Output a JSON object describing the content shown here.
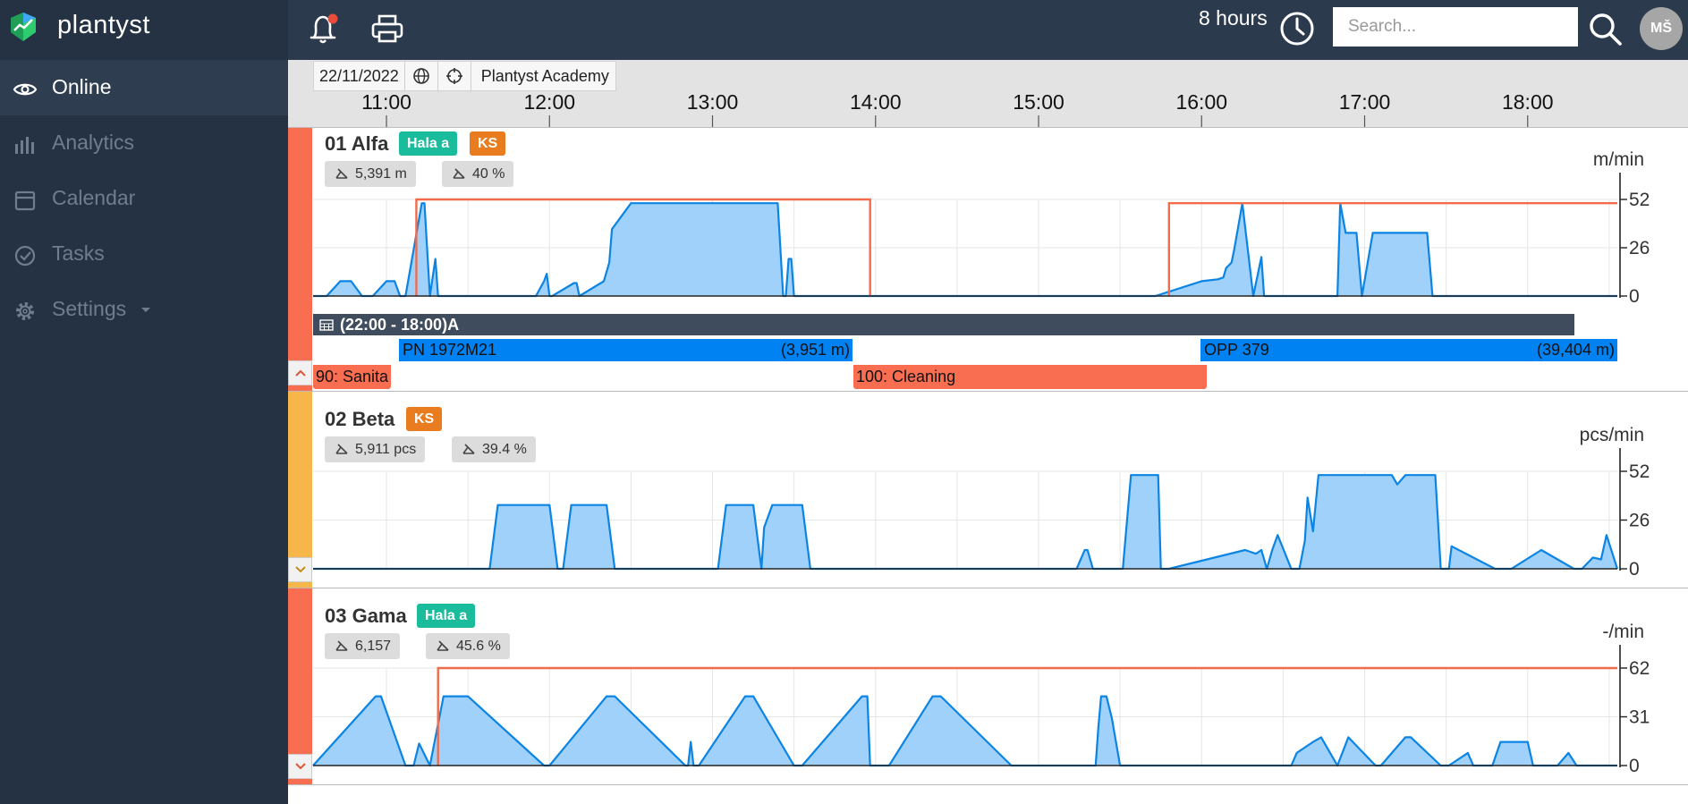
{
  "brand": {
    "name": "plantyst"
  },
  "nav": [
    {
      "label": "Online",
      "icon": "eye-icon",
      "active": true
    },
    {
      "label": "Analytics",
      "icon": "bar-chart-icon",
      "active": false
    },
    {
      "label": "Calendar",
      "icon": "calendar-icon",
      "active": false
    },
    {
      "label": "Tasks",
      "icon": "check-circle-icon",
      "active": false
    },
    {
      "label": "Settings",
      "icon": "gear-icon",
      "active": false,
      "has_dropdown": true
    }
  ],
  "topbar": {
    "notification_icon": "bell-icon",
    "notification_badge_color": "#e74c3c",
    "print_icon": "printer-icon",
    "time_range_label": "8 hours",
    "time_range_icon": "clock-icon",
    "search_placeholder": "Search...",
    "search_value": "",
    "search_icon": "search-icon",
    "avatar_initials": "MŠ"
  },
  "timeline": {
    "date": "22/11/2022",
    "timezone_icon": "globe-icon",
    "locate_icon": "crosshair-icon",
    "factory": "Plantyst Academy",
    "ticks": [
      "11:00",
      "12:00",
      "13:00",
      "14:00",
      "15:00",
      "16:00",
      "17:00",
      "18:00"
    ]
  },
  "colors": {
    "alarm": "#f96e51",
    "warning": "#f6b64a",
    "series_line": "#0b84e4",
    "series_fill": "#9fd1fa",
    "target_line": "#f26b4b",
    "tag_teal": "#1abc9c",
    "tag_orange": "#e87c1e",
    "order_bar": "#0082f2",
    "shift_bar": "#3e4c5e"
  },
  "machines": [
    {
      "name": "01 Alfa",
      "tags": [
        {
          "label": "Hala a",
          "color": "teal"
        },
        {
          "label": "KS",
          "color": "orange"
        }
      ],
      "stats": [
        {
          "label": "5,391 m"
        },
        {
          "label": "40 %"
        }
      ],
      "status_color": "#f96e51",
      "collapse_icon": "chevron-up-icon",
      "shift": {
        "label": "(22:00 - 18:00)",
        "code": "A",
        "icon": "calendar-grid-icon"
      },
      "orders": [
        {
          "name": "PN 1972M21",
          "amount": "(3,951 m)"
        },
        {
          "name": "OPP 379",
          "amount": "(39,404 m)"
        }
      ],
      "events": [
        {
          "label": "90: Sanita"
        },
        {
          "label": "100: Cleaning"
        }
      ]
    },
    {
      "name": "02 Beta",
      "tags": [
        {
          "label": "KS",
          "color": "orange"
        }
      ],
      "stats": [
        {
          "label": "5,911 pcs"
        },
        {
          "label": "39.4 %"
        }
      ],
      "status_color": "#f6b64a",
      "collapse_icon": "chevron-down-icon"
    },
    {
      "name": "03 Gama",
      "tags": [
        {
          "label": "Hala a",
          "color": "teal"
        }
      ],
      "stats": [
        {
          "label": "6,157"
        },
        {
          "label": "45.6 %"
        }
      ],
      "status_color": "#f96e51",
      "collapse_icon": "chevron-down-icon"
    }
  ],
  "chart_data": [
    {
      "type": "area",
      "xlabel": "",
      "ylabel": "m/min",
      "xlim": [
        "10:33",
        "18:33"
      ],
      "ylim": [
        0,
        52
      ],
      "yticks": [
        0,
        26,
        52
      ],
      "series": [
        {
          "x": [
            "10:33",
            "10:38",
            "10:43",
            "10:47",
            "10:51",
            "10:55",
            "11:00",
            "11:03",
            "11:05",
            "11:07",
            "11:13",
            "11:14",
            "11:16",
            "11:18",
            "11:19",
            "11:20",
            "11:22",
            "11:24",
            "11:55",
            "11:58",
            "11:59",
            "12:00",
            "12:01",
            "12:09",
            "12:10",
            "12:11",
            "12:20",
            "12:22",
            "12:23",
            "12:30",
            "12:33",
            "12:59",
            "13:24",
            "13:26",
            "13:27",
            "13:28",
            "13:29",
            "13:30",
            "13:32",
            "13:34",
            "15:43",
            "16:00",
            "16:06",
            "16:08",
            "16:09",
            "16:11",
            "16:12",
            "16:15",
            "16:19",
            "16:22",
            "16:23",
            "16:25",
            "16:26",
            "16:28",
            "16:34",
            "16:50",
            "16:51",
            "16:53",
            "16:57",
            "16:59",
            "17:03",
            "17:23",
            "17:25",
            "18:33"
          ],
          "y": [
            0,
            0,
            8,
            8,
            0,
            0,
            8,
            8,
            0,
            0,
            50,
            50,
            0,
            20,
            0,
            0,
            0,
            0,
            0,
            8,
            12,
            0,
            0,
            7,
            7,
            0,
            8,
            18,
            36,
            50,
            50,
            50,
            50,
            0,
            0,
            20,
            20,
            0,
            0,
            0,
            0,
            8,
            9,
            10,
            15,
            18,
            25,
            50,
            0,
            21,
            0,
            0,
            0,
            0,
            0,
            0,
            50,
            34,
            34,
            0,
            34,
            34,
            0,
            0
          ]
        }
      ],
      "targets": [
        {
          "start": "11:11",
          "end": "13:58",
          "y": 52
        },
        {
          "start": "15:48",
          "end": "18:33",
          "y": 50
        }
      ]
    },
    {
      "type": "area",
      "xlabel": "",
      "ylabel": "pcs/min",
      "xlim": [
        "10:33",
        "18:33"
      ],
      "ylim": [
        0,
        52
      ],
      "yticks": [
        0,
        26,
        52
      ],
      "series": [
        {
          "x": [
            "10:33",
            "11:38",
            "11:41",
            "12:00",
            "12:03",
            "12:05",
            "12:08",
            "12:21",
            "12:24",
            "13:02",
            "13:05",
            "13:15",
            "13:18",
            "13:19",
            "13:22",
            "13:33",
            "13:36",
            "15:14",
            "15:17",
            "15:18",
            "15:20",
            "15:31",
            "15:34",
            "15:44",
            "15:45",
            "15:48",
            "16:16",
            "16:20",
            "16:22",
            "16:24",
            "16:26",
            "16:28",
            "16:33",
            "16:36",
            "16:38",
            "16:39",
            "16:41",
            "16:43",
            "16:45",
            "17:10",
            "17:12",
            "17:15",
            "17:18",
            "17:20",
            "17:22",
            "17:24",
            "17:26",
            "17:28",
            "17:31",
            "17:32",
            "17:48",
            "17:54",
            "18:05",
            "18:17",
            "18:20",
            "18:24",
            "18:27",
            "18:29",
            "18:33"
          ],
          "y": [
            0,
            0,
            34,
            34,
            0,
            0,
            34,
            34,
            0,
            0,
            34,
            34,
            0,
            22,
            34,
            34,
            0,
            0,
            10,
            10,
            0,
            0,
            50,
            50,
            0,
            0,
            10,
            8,
            10,
            0,
            10,
            18,
            0,
            0,
            15,
            38,
            20,
            50,
            50,
            50,
            45,
            50,
            50,
            50,
            50,
            50,
            50,
            0,
            0,
            12,
            0,
            0,
            10,
            0,
            0,
            6,
            5,
            18,
            0
          ]
        }
      ],
      "targets": []
    },
    {
      "type": "area",
      "xlabel": "",
      "ylabel": "-/min",
      "xlim": [
        "10:33",
        "18:33"
      ],
      "ylim": [
        0,
        62
      ],
      "yticks": [
        0,
        31,
        62
      ],
      "series": [
        {
          "x": [
            "10:33",
            "10:56",
            "10:58",
            "11:07",
            "11:10",
            "11:12",
            "11:16",
            "11:21",
            "11:30",
            "11:58",
            "12:00",
            "12:21",
            "12:24",
            "12:50",
            "12:51",
            "12:52",
            "12:53",
            "12:55",
            "13:12",
            "13:15",
            "13:30",
            "13:33",
            "13:55",
            "13:57",
            "13:58",
            "14:00",
            "14:05",
            "14:21",
            "14:24",
            "14:50",
            "15:21",
            "15:22",
            "15:23",
            "15:25",
            "15:27",
            "15:30",
            "15:31",
            "16:33",
            "16:35",
            "16:41",
            "16:44",
            "16:50",
            "16:54",
            "17:04",
            "17:06",
            "17:15",
            "17:17",
            "17:28",
            "17:31",
            "17:38",
            "17:40",
            "17:47",
            "17:50",
            "18:00",
            "18:02",
            "18:11",
            "18:15",
            "18:18",
            "18:33"
          ],
          "y": [
            0,
            44,
            44,
            0,
            0,
            14,
            0,
            44,
            44,
            0,
            0,
            44,
            44,
            0,
            0,
            15,
            0,
            0,
            44,
            44,
            0,
            0,
            44,
            44,
            0,
            0,
            0,
            44,
            44,
            0,
            0,
            24,
            44,
            44,
            30,
            0,
            0,
            0,
            8,
            15,
            18,
            0,
            18,
            0,
            0,
            18,
            18,
            0,
            0,
            8,
            0,
            0,
            15,
            15,
            0,
            0,
            8,
            0,
            0
          ]
        }
      ],
      "targets": [
        {
          "start": "11:19",
          "end": "18:33",
          "y": 62
        }
      ]
    }
  ]
}
